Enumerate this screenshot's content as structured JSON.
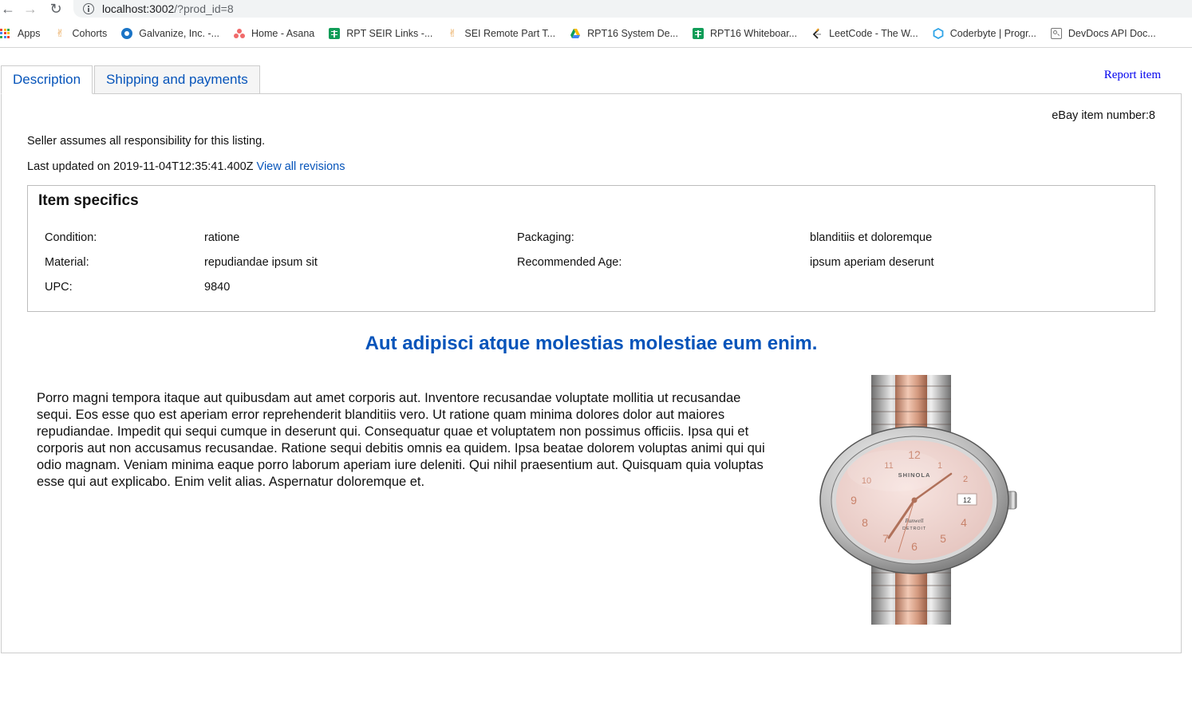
{
  "browser": {
    "url_host": "localhost:3002",
    "url_path": "/?prod_id=8",
    "bookmarks": [
      {
        "label": "Apps",
        "icon": "apps-grid-icon"
      },
      {
        "label": "Cohorts",
        "icon": "hand-icon"
      },
      {
        "label": "Galvanize, Inc. -...",
        "icon": "galvanize-icon"
      },
      {
        "label": "Home - Asana",
        "icon": "asana-icon"
      },
      {
        "label": "RPT SEIR Links -...",
        "icon": "sheets-icon"
      },
      {
        "label": "SEI Remote Part T...",
        "icon": "hand-icon"
      },
      {
        "label": "RPT16 System De...",
        "icon": "drive-icon"
      },
      {
        "label": "RPT16 Whiteboar...",
        "icon": "sheets-icon"
      },
      {
        "label": "LeetCode - The W...",
        "icon": "leetcode-icon"
      },
      {
        "label": "Coderbyte | Progr...",
        "icon": "coderbyte-icon"
      },
      {
        "label": "DevDocs API Doc...",
        "icon": "devdocs-icon"
      }
    ]
  },
  "tabs": {
    "description": "Description",
    "shipping": "Shipping and payments"
  },
  "report_item": "Report item",
  "item_number_label": "eBay item number:8",
  "responsibility": "Seller assumes all responsibility for this listing.",
  "updated": {
    "text": "Last updated on 2019-11-04T12:35:41.400Z",
    "link": "View all revisions"
  },
  "specifics": {
    "title": "Item specifics",
    "rows": [
      {
        "l1": "Condition:",
        "v1": "ratione",
        "l2": "Packaging:",
        "v2": "blanditiis et doloremque"
      },
      {
        "l1": "Material:",
        "v1": "repudiandae ipsum sit",
        "l2": "Recommended Age:",
        "v2": "ipsum aperiam deserunt"
      },
      {
        "l1": "UPC:",
        "v1": "9840",
        "l2": "",
        "v2": ""
      }
    ]
  },
  "headline": "Aut adipisci atque molestias molestiae eum enim.",
  "description": "Porro magni tempora itaque aut quibusdam aut amet corporis aut. Inventore recusandae voluptate mollitia ut recusandae sequi. Eos esse quo est aperiam error reprehenderit blanditiis vero. Ut ratione quam minima dolores dolor aut maiores repudiandae. Impedit qui sequi cumque in deserunt qui. Consequatur quae et voluptatem non possimus officiis. Ipsa qui et corporis aut non accusamus recusandae. Ratione sequi debitis omnis ea quidem. Ipsa beatae dolorem voluptas animi qui qui odio magnam. Veniam minima eaque porro laborum aperiam iure deleniti. Qui nihil praesentium aut. Quisquam quia voluptas esse qui aut explicabo. Enim velit alias. Aspernatur doloremque et.",
  "product_image": {
    "icon": "wristwatch-image",
    "brand": "SHINOLA",
    "model": "Runwell",
    "city": "DETROIT",
    "date_window": "12"
  },
  "colors": {
    "link_blue": "#0654ba",
    "report_link": "#0000ee",
    "dial": "#f3d9d5",
    "rose_gold": "#d39c83"
  }
}
